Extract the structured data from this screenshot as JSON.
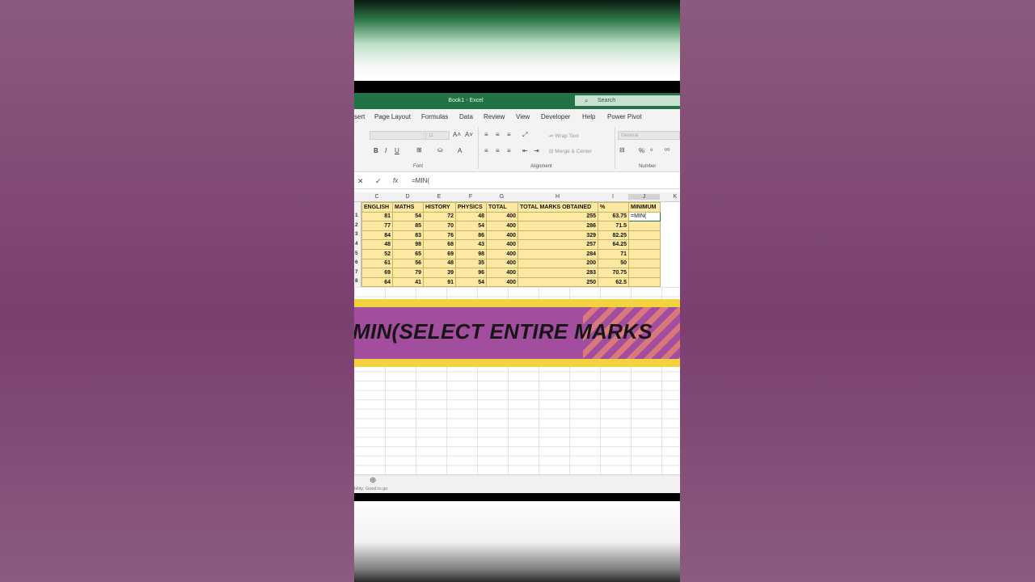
{
  "window": {
    "title": "Book1  -  Excel",
    "search_placeholder": "Search"
  },
  "ribbon_tabs": [
    "sert",
    "Page Layout",
    "Formulas",
    "Data",
    "Review",
    "View",
    "Developer",
    "Help",
    "Power Pivot"
  ],
  "ribbon": {
    "font_size": "11",
    "wrap_text": "Wrap Text",
    "merge_center": "Merge & Center",
    "number_format": "General",
    "groups": {
      "font": "Font",
      "alignment": "Alignment",
      "number": "Number"
    }
  },
  "formula_bar": {
    "content": "=MIN("
  },
  "columns": [
    "C",
    "D",
    "E",
    "F",
    "G",
    "H",
    "I",
    "J",
    "K"
  ],
  "table": {
    "headers": [
      "ENGLISH",
      "MATHS",
      "HISTORY",
      "PHYSICS",
      "TOTAL",
      "TOTAL MARKS OBTAINED",
      "%",
      "MINIMUM"
    ],
    "row_numbers": [
      "1",
      "2",
      "3",
      "4",
      "5",
      "6",
      "7",
      "8"
    ],
    "rows": [
      [
        "81",
        "54",
        "72",
        "48",
        "400",
        "255",
        "63.75",
        "=MIN("
      ],
      [
        "77",
        "85",
        "70",
        "54",
        "400",
        "286",
        "71.5",
        ""
      ],
      [
        "84",
        "83",
        "76",
        "86",
        "400",
        "329",
        "82.25",
        ""
      ],
      [
        "48",
        "98",
        "68",
        "43",
        "400",
        "257",
        "64.25",
        ""
      ],
      [
        "52",
        "65",
        "69",
        "98",
        "400",
        "284",
        "71",
        ""
      ],
      [
        "61",
        "56",
        "48",
        "35",
        "400",
        "200",
        "50",
        ""
      ],
      [
        "69",
        "79",
        "39",
        "96",
        "400",
        "283",
        "70.75",
        ""
      ],
      [
        "64",
        "41",
        "91",
        "54",
        "400",
        "250",
        "62.5",
        ""
      ]
    ]
  },
  "banner": {
    "text": "MIN(SELECT ENTIRE MARKS"
  },
  "status": {
    "text": "bility: Good to go"
  },
  "colors": {
    "excel_green": "#217346",
    "cell_fill": "#fde9a1",
    "banner_purple": "#a24d9e",
    "banner_yellow": "#f2d23e"
  }
}
